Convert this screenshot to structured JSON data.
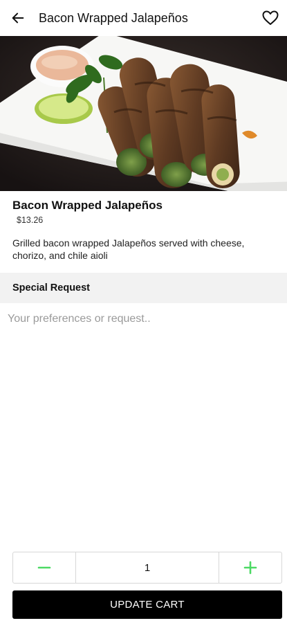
{
  "header": {
    "title": "Bacon Wrapped Jalapeños",
    "back_icon": "arrow-left-icon",
    "favorite_icon": "heart-outline-icon"
  },
  "item": {
    "name": "Bacon Wrapped Jalapeños",
    "price": "$13.26",
    "description": "Grilled bacon wrapped Jalapeños served with cheese, chorizo, and chile aioli"
  },
  "special_request": {
    "heading": "Special Request",
    "placeholder": "Your preferences or request..",
    "value": ""
  },
  "quantity": {
    "value": "1",
    "decrement_icon": "minus-icon",
    "increment_icon": "plus-icon",
    "accent_color": "#4cd964"
  },
  "cart": {
    "update_label": "UPDATE CART"
  }
}
